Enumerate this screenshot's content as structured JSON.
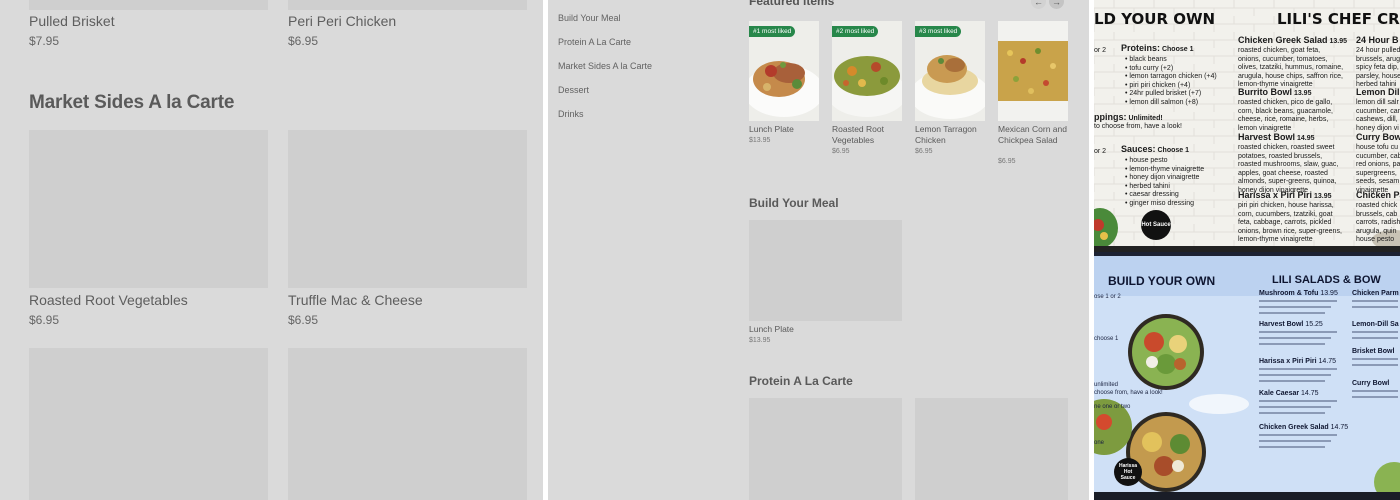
{
  "panel1": {
    "top_items": [
      {
        "name": "Pulled Brisket",
        "price": "$7.95"
      },
      {
        "name": "Peri Peri Chicken",
        "price": "$6.95"
      }
    ],
    "section_title": "Market Sides A la Carte",
    "items": [
      {
        "name": "Roasted Root Vegetables",
        "price": "$6.95"
      },
      {
        "name": "Truffle Mac & Cheese",
        "price": "$6.95"
      }
    ]
  },
  "panel2": {
    "nav": [
      "Build Your Meal",
      "Protein A La Carte",
      "Market Sides A la Carte",
      "Dessert",
      "Drinks"
    ],
    "featured_title": "Featured items",
    "featured": [
      {
        "badge": "#1 most liked",
        "name": "Lunch Plate",
        "price": "$13.95"
      },
      {
        "badge": "#2 most liked",
        "name": "Roasted Root Vegetables",
        "price": "$6.95"
      },
      {
        "badge": "#3 most liked",
        "name": "Lemon Tarragon Chicken",
        "price": "$6.95"
      },
      {
        "badge": "",
        "name": "Mexican Corn and Chickpea Salad",
        "price": "$6.95"
      }
    ],
    "build_title": "Build Your Meal",
    "build_item": {
      "name": "Lunch Plate",
      "price": "$13.95"
    },
    "protein_title": "Protein A La Carte",
    "icons": {
      "prev": "arrow-left-icon",
      "next": "arrow-right-icon"
    }
  },
  "menu_top": {
    "left_heading": "LD YOUR OWN",
    "right_heading": "LILI'S CHEF CREATI",
    "proteins_label": "Proteins:",
    "proteins_choose": "Choose 1",
    "proteins_prefix": "or 2",
    "proteins": [
      "black beans",
      "tofu curry (+2)",
      "lemon tarragon chicken (+4)",
      "piri piri chicken (+4)",
      "24hr pulled brisket (+7)",
      "lemon dill salmon (+8)"
    ],
    "toppings_label": "ppings:",
    "toppings_value": "Unlimited!",
    "toppings_desc": "to choose from, have a look!",
    "sauces_prefix": "or 2",
    "sauces_label": "Sauces:",
    "sauces_choose": "Choose 1",
    "sauces": [
      "house pesto",
      "lemon-thyme vinaigrette",
      "honey dijon vinaigrette",
      "herbed tahini",
      "caesar dressing",
      "ginger miso dressing"
    ],
    "hot_sauce": "Hot Sauce",
    "dishes": [
      {
        "name": "Chicken Greek Salad",
        "price": "13.95",
        "lines": [
          "roasted chicken, goat feta,",
          "onions, cucumber, tomatoes,",
          "olives, tzatziki, hummus, romaine,",
          "arugula, house chips, saffron rice,",
          "lemon-thyme vinaigrette"
        ]
      },
      {
        "name": "Burrito Bowl",
        "price": "13.95",
        "lines": [
          "roasted chicken, pico de gallo,",
          "corn, black beans, guacamole,",
          "cheese, rice, romaine, herbs,",
          "lemon vinaigrette"
        ]
      },
      {
        "name": "Harvest Bowl",
        "price": "14.95",
        "lines": [
          "roasted chicken, roasted sweet",
          "potatoes, roasted brussels,",
          "roasted mushrooms, slaw, guac,",
          "apples, goat cheese, roasted",
          "almonds, super-greens, quinoa,",
          "honey dijon vinaigrette"
        ]
      },
      {
        "name": "Harissa x Piri Piri",
        "price": "13.95",
        "lines": [
          "piri piri chicken, house harissa,",
          "corn, cucumbers, tzatziki, goat",
          "feta, cabbage, carrots, pickled",
          "onions, brown rice, super-greens,",
          "lemon-thyme vinaigrette"
        ]
      }
    ],
    "right_dishes": [
      {
        "name": "24 Hour B",
        "lines": [
          "24 hour pulled",
          "brussels, arug",
          "spicy feta dip,",
          "parsley, house",
          "herbed tahini"
        ]
      },
      {
        "name": "Lemon Dill",
        "lines": [
          "lemon dill salr",
          "cucumber, car",
          "cashews, dill,",
          "honey dijon vi"
        ]
      },
      {
        "name": "Curry Bow",
        "lines": [
          "house tofu cu",
          "cucumber, cab",
          "red onions, pa",
          "supergreens,",
          "seeds, sesam",
          "vinaigrette"
        ]
      },
      {
        "name": "Chicken Pa",
        "lines": [
          "roasted chick",
          "brussels, cab",
          "carrots, radish",
          "arugula, quin",
          "house pesto"
        ]
      }
    ]
  },
  "menu_tv": {
    "left_heading": "BUILD YOUR OWN",
    "right_heading": "LILI SALADS & BOW",
    "choose_line": "ose 1 or 2",
    "hot_sauce": "Harissa Hot Sauce",
    "left_lines": [
      "choose 1",
      "unlimited",
      "choose from, have a look!",
      "ne one or two",
      "one"
    ],
    "dishes": [
      {
        "name": "Mushroom & Tofu",
        "price": "13.95"
      },
      {
        "name": "Harvest Bowl",
        "price": "15.25"
      },
      {
        "name": "Harissa x Piri Piri",
        "price": "14.75"
      },
      {
        "name": "Kale Caesar",
        "price": "14.75"
      },
      {
        "name": "Chicken Greek Salad",
        "price": "14.75"
      }
    ],
    "right_dishes": [
      "Chicken Parm B",
      "Lemon-Dill Sa",
      "Brisket Bowl",
      "Curry Bowl"
    ]
  },
  "colors": {
    "badge": "#27874a",
    "overlay_gray": "#dadada",
    "tv_blue": "#cfe0f6"
  }
}
